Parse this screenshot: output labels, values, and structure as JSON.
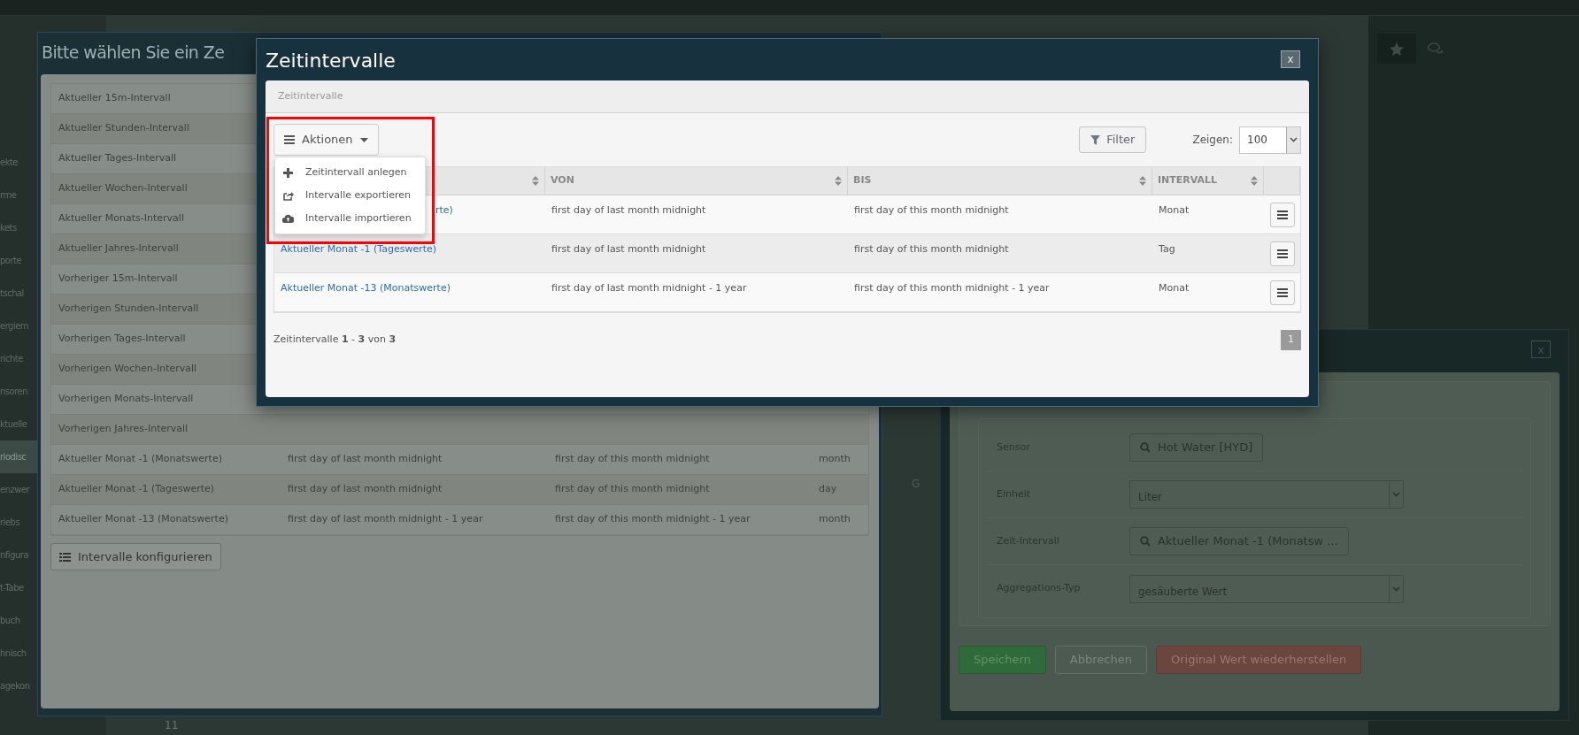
{
  "sidebar": {
    "items": [
      {
        "label": "ekte",
        "selected": false
      },
      {
        "label": "rme",
        "selected": false
      },
      {
        "label": "kets",
        "selected": false
      },
      {
        "label": "porte",
        "selected": false
      },
      {
        "label": "tschal",
        "selected": false
      },
      {
        "label": "ergiem",
        "selected": false
      },
      {
        "label": "richte",
        "selected": false
      },
      {
        "label": "nsoren",
        "selected": false
      },
      {
        "label": "ktuelle",
        "selected": false
      },
      {
        "label": "riodisc",
        "selected": true
      },
      {
        "label": "enzwer",
        "selected": false
      },
      {
        "label": "riebs",
        "selected": false
      },
      {
        "label": "nfigura",
        "selected": false
      },
      {
        "label": "t-Tabe",
        "selected": false
      },
      {
        "label": "buch",
        "selected": false
      },
      {
        "label": "hnisch",
        "selected": false
      },
      {
        "label": "agekon",
        "selected": false
      }
    ]
  },
  "background": {
    "column_marker": "G",
    "row_number": "11"
  },
  "interval_picker": {
    "title": "Bitte wählen Sie ein Ze",
    "rows": [
      {
        "name": "Aktueller 15m-Intervall"
      },
      {
        "name": "Aktueller Stunden-Intervall"
      },
      {
        "name": "Aktueller Tages-Intervall"
      },
      {
        "name": "Aktueller Wochen-Intervall"
      },
      {
        "name": "Aktueller Monats-Intervall"
      },
      {
        "name": "Aktueller Jahres-Intervall"
      },
      {
        "name": "Vorheriger 15m-Intervall"
      },
      {
        "name": "Vorherigen Stunden-Intervall"
      },
      {
        "name": "Vorherigen Tages-Intervall"
      },
      {
        "name": "Vorherigen Wochen-Intervall"
      },
      {
        "name": "Vorherigen Monats-Intervall"
      },
      {
        "name": "Vorherigen Jahres-Intervall"
      },
      {
        "name": "Aktueller Monat -1 (Monatswerte)",
        "von": "first day of last month midnight",
        "bis": "first day of this month midnight",
        "intervall": "month"
      },
      {
        "name": "Aktueller Monat -1 (Tageswerte)",
        "von": "first day of last month midnight",
        "bis": "first day of this month midnight",
        "intervall": "day"
      },
      {
        "name": "Aktueller Monat -13 (Monatswerte)",
        "von": "first day of last month midnight - 1 year",
        "bis": "first day of this month midnight - 1 year",
        "intervall": "month"
      }
    ],
    "configure_button": "Intervalle konfigurieren"
  },
  "sensor_dialog": {
    "close": "x",
    "fields": [
      {
        "kind": "search",
        "label": "Sensor",
        "value": "Hot Water [HYD]"
      },
      {
        "kind": "select",
        "label": "Einheit",
        "value": "Liter"
      },
      {
        "kind": "search",
        "label": "Zeit-Intervall",
        "value": "Aktueller Monat -1 (Monatsw ..."
      },
      {
        "kind": "select",
        "label": "Aggregations-Typ",
        "value": "gesäuberte Wert"
      }
    ],
    "buttons": [
      {
        "kind": "success",
        "label": "Speichern"
      },
      {
        "kind": "default",
        "label": "Abbrechen"
      },
      {
        "kind": "danger",
        "label": "Original Wert wiederherstellen"
      }
    ]
  },
  "dialog": {
    "title": "Zeitintervalle",
    "close": "x",
    "panel_title": "Zeitintervalle",
    "actions_button": "Aktionen",
    "actions_menu": [
      {
        "kind": "create",
        "label": "Zeitintervall anlegen"
      },
      {
        "kind": "export",
        "label": "Intervalle exportieren"
      },
      {
        "kind": "import",
        "label": "Intervalle importieren"
      }
    ],
    "filter_button": "Filter",
    "page_size_label": "Zeigen:",
    "page_size": "100",
    "columns": [
      {
        "sortable": true
      },
      {
        "label": "VON",
        "sortable": true
      },
      {
        "label": "BIS",
        "sortable": true
      },
      {
        "label": "INTERVALL",
        "sortable": true
      },
      {
        "sortable": false
      }
    ],
    "rows": [
      {
        "name": "rte)",
        "cut": true,
        "von": "first day of last month midnight",
        "bis": "first day of this month midnight",
        "intervall": "Monat"
      },
      {
        "name": "Aktueller Monat -1 (Tageswerte)",
        "cut": false,
        "von": "first day of last month midnight",
        "bis": "first day of this month midnight",
        "intervall": "Tag"
      },
      {
        "name": "Aktueller Monat -13 (Monatswerte)",
        "cut": false,
        "von": "first day of last month midnight - 1 year",
        "bis": "first day of this month midnight - 1 year",
        "intervall": "Monat"
      }
    ],
    "summary": "Zeitintervalle **1** - **3** von **3**",
    "pages": [
      {
        "label": "1",
        "selected": true
      }
    ]
  }
}
